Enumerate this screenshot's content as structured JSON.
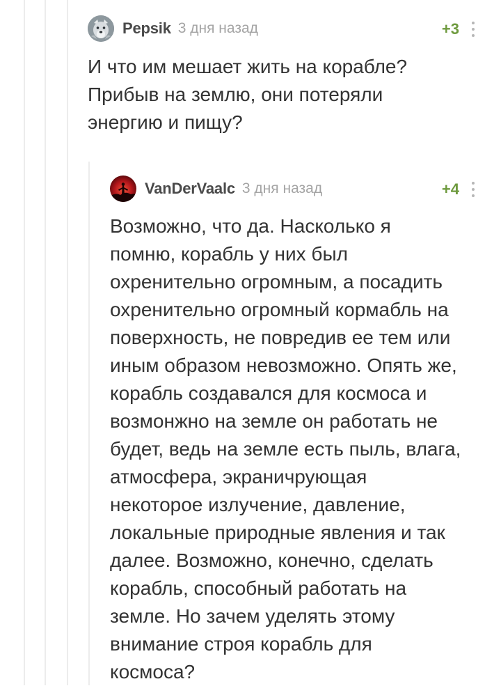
{
  "comments": [
    {
      "username": "Pepsik",
      "timestamp": "3 дня назад",
      "rating": "+3",
      "avatar_icon": "wolf-avatar",
      "text": "И что им мешает жить на корабле?\nПрибыв на землю, они потеряли\nэнергию и пищу?"
    },
    {
      "username": "VanDerVaalc",
      "timestamp": "3 дня назад",
      "rating": "+4",
      "avatar_icon": "red-sunset-avatar",
      "text": "Возможно, что да. Насколько я\nпомню, корабль у них был\nохренительно огромным, а посадить\nохренительно огромный кормабль на\nповерхность, не повредив ее тем или\nиным образом невозможно. Опять же,\nкорабль создавался для космоса и\nвозмонжно на земле он работать не\nбудет, ведь на земле есть пыль, влага,\nатмосфера, экраничрующая\nнекоторое излучение, давление,\nлокальные природные явления и так\nдалее. Возможно, конечно, сделать\nкорабль, способный работать на\nземле. Но зачем уделять этому\nвнимание строя корабль для\nкосмоса?"
    }
  ],
  "colors": {
    "rating_positive": "#6e9a3e",
    "timestamp": "#a4a4a4",
    "thread_line": "#ececec"
  }
}
